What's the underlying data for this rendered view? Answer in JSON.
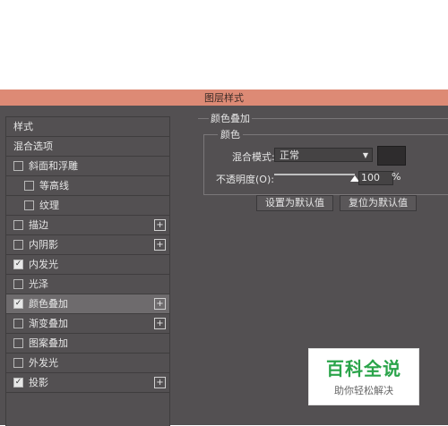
{
  "dialog_title": "图层样式",
  "style_list": [
    {
      "label": "样式",
      "checkbox": false,
      "checked": false,
      "plus": false,
      "active": false,
      "sub": false
    },
    {
      "label": "混合选项",
      "checkbox": false,
      "checked": false,
      "plus": false,
      "active": false,
      "sub": false
    },
    {
      "label": "斜面和浮雕",
      "checkbox": true,
      "checked": false,
      "plus": false,
      "active": false,
      "sub": false
    },
    {
      "label": "等高线",
      "checkbox": true,
      "checked": false,
      "plus": false,
      "active": false,
      "sub": true
    },
    {
      "label": "纹理",
      "checkbox": true,
      "checked": false,
      "plus": false,
      "active": false,
      "sub": true
    },
    {
      "label": "描边",
      "checkbox": true,
      "checked": false,
      "plus": true,
      "active": false,
      "sub": false
    },
    {
      "label": "内阴影",
      "checkbox": true,
      "checked": false,
      "plus": true,
      "active": false,
      "sub": false
    },
    {
      "label": "内发光",
      "checkbox": true,
      "checked": true,
      "plus": false,
      "active": false,
      "sub": false
    },
    {
      "label": "光泽",
      "checkbox": true,
      "checked": false,
      "plus": false,
      "active": false,
      "sub": false
    },
    {
      "label": "颜色叠加",
      "checkbox": true,
      "checked": true,
      "plus": true,
      "active": true,
      "sub": false
    },
    {
      "label": "渐变叠加",
      "checkbox": true,
      "checked": false,
      "plus": true,
      "active": false,
      "sub": false
    },
    {
      "label": "图案叠加",
      "checkbox": true,
      "checked": false,
      "plus": false,
      "active": false,
      "sub": false
    },
    {
      "label": "外发光",
      "checkbox": true,
      "checked": false,
      "plus": false,
      "active": false,
      "sub": false
    },
    {
      "label": "投影",
      "checkbox": true,
      "checked": true,
      "plus": true,
      "active": false,
      "sub": false
    }
  ],
  "color_overlay": {
    "title": "颜色叠加",
    "subgroup": "颜色",
    "blend_mode_label": "混合模式:",
    "blend_mode_value": "正常",
    "opacity_label": "不透明度(O):",
    "opacity_value": "100",
    "opacity_unit": "%",
    "opacity_fraction": 1.0,
    "swatch_color": "#2e2c2d",
    "set_default_label": "设置为默认值",
    "reset_default_label": "复位为默认值"
  },
  "watermark": {
    "title": "百科全说",
    "subtitle": "助你轻松解决"
  },
  "colors": {
    "title_bar": "#dd8a75",
    "panel_bg": "#535052",
    "active_row": "#6e6b6d",
    "brand_green": "#2aa44a"
  }
}
